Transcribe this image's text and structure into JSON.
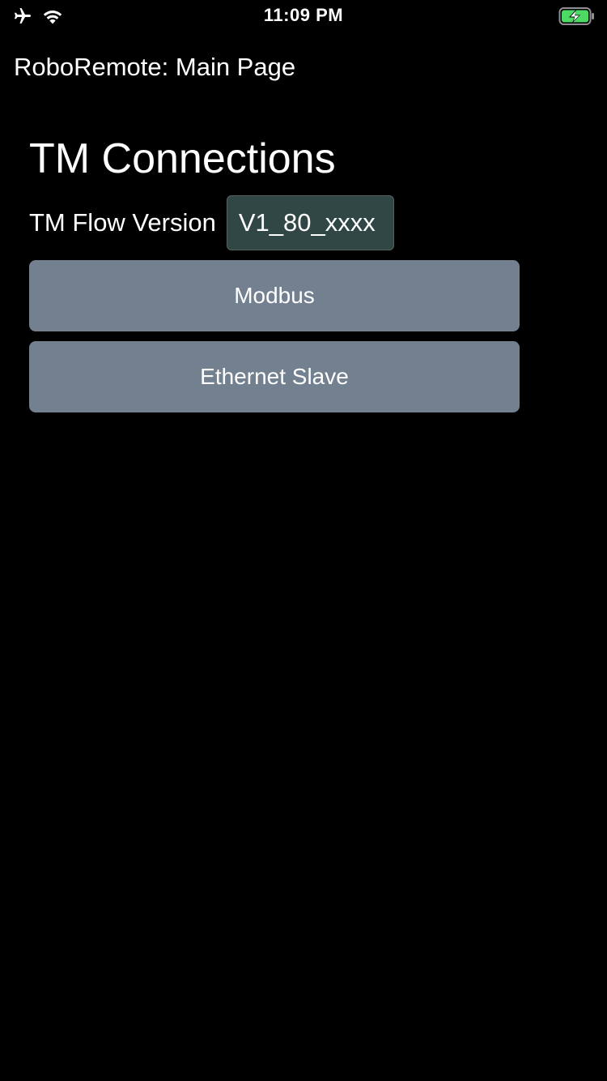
{
  "status_bar": {
    "time": "11:09 PM",
    "icons": [
      "airplane-icon",
      "wifi-icon",
      "battery-charging-icon"
    ],
    "battery_color": "#4cd964"
  },
  "nav": {
    "title": "RoboRemote: Main Page"
  },
  "main": {
    "section_title": "TM Connections",
    "version_label": "TM Flow Version",
    "version_value": "V1_80_xxxx",
    "buttons": [
      {
        "label": "Modbus"
      },
      {
        "label": "Ethernet Slave"
      }
    ]
  },
  "colors": {
    "background": "#000000",
    "button": "#738090",
    "field": "#304745"
  }
}
